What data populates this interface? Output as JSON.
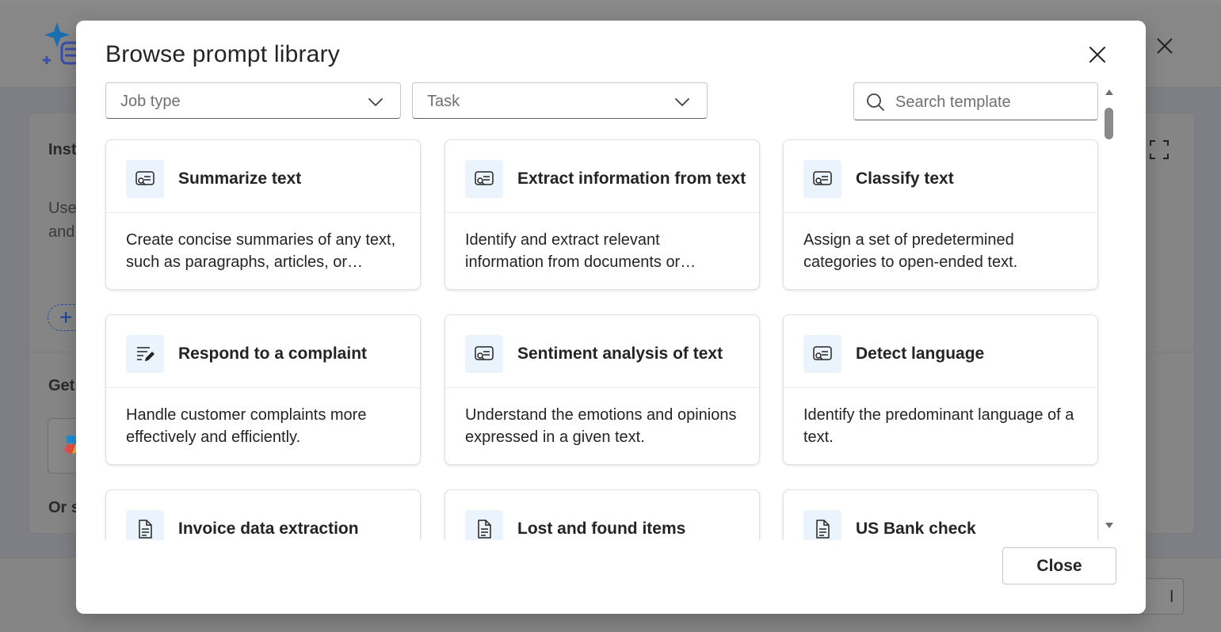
{
  "background": {
    "section_labels": [
      "Inst",
      "Use",
      "and",
      "Get",
      "Or s"
    ],
    "cancel_partial": "l"
  },
  "dialog": {
    "title": "Browse prompt library",
    "filters": {
      "job_type_placeholder": "Job type",
      "task_placeholder": "Task",
      "search_placeholder": "Search template"
    },
    "close_button_label": "Close",
    "cards": [
      {
        "title": "Summarize text",
        "description": "Create concise summaries of any text, such as paragraphs, articles, or…",
        "icon": "text-search-icon"
      },
      {
        "title": "Extract information from text",
        "description": "Identify and extract relevant information from documents or…",
        "icon": "text-search-icon"
      },
      {
        "title": "Classify text",
        "description": "Assign a set of predetermined categories to open-ended text.",
        "icon": "text-search-icon"
      },
      {
        "title": "Respond to a complaint",
        "description": "Handle customer complaints more effectively and efficiently.",
        "icon": "text-edit-icon"
      },
      {
        "title": "Sentiment analysis of text",
        "description": "Understand the emotions and opinions expressed in a given text.",
        "icon": "text-search-icon"
      },
      {
        "title": "Detect language",
        "description": "Identify the predominant language of a text.",
        "icon": "text-search-icon"
      },
      {
        "title": "Invoice data extraction",
        "description": "",
        "icon": "document-icon"
      },
      {
        "title": "Lost and found items",
        "description": "",
        "icon": "document-icon"
      },
      {
        "title": "US Bank check",
        "description": "",
        "icon": "document-icon"
      }
    ]
  }
}
